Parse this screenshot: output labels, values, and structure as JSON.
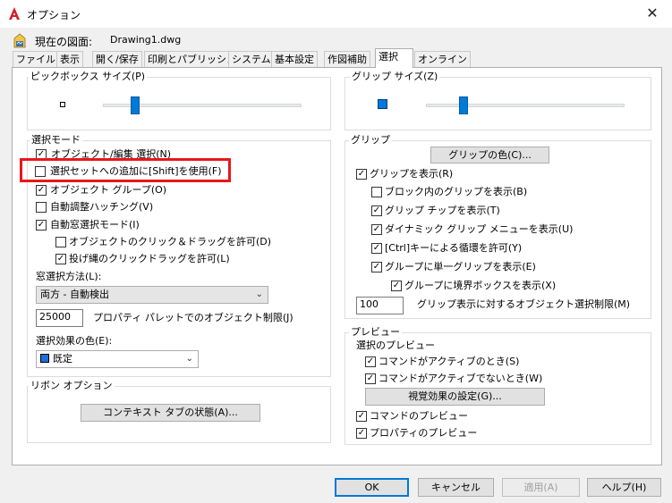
{
  "window": {
    "title": "オプション",
    "close_glyph": "✕"
  },
  "profile": {
    "current_drawing_label": "現在の図面:",
    "current_drawing_value": "Drawing1.dwg"
  },
  "tabs": [
    "ファイル",
    "表示",
    "開く/保存",
    "印刷とパブリッシュ",
    "システム",
    "基本設定",
    "作図補助",
    "選択",
    "オンライン"
  ],
  "active_tab": "選択",
  "pickbox": {
    "title": "ピックボックス サイズ(P)",
    "level_fraction": 0.16
  },
  "grip_size": {
    "title": "グリップ サイズ(Z)",
    "level_fraction": 0.19
  },
  "selection_modes": {
    "title": "選択モード",
    "items": [
      {
        "label": "オブジェクト/編集 選択(N)",
        "checked": true
      },
      {
        "label": "選択セットへの追加に[Shift]を使用(F)",
        "checked": false
      },
      {
        "label": "オブジェクト グループ(O)",
        "checked": true
      },
      {
        "label": "自動調整ハッチング(V)",
        "checked": false
      },
      {
        "label": "自動窓選択モード(I)",
        "checked": true
      },
      {
        "label": "オブジェクトのクリック＆ドラッグを許可(D)",
        "checked": false
      },
      {
        "label": "投げ縄のクリックドラッグを許可(L)",
        "checked": true
      }
    ],
    "window_method_label": "窓選択方法(L):",
    "window_method_value": "両方 - 自動検出",
    "object_limit_value": "25000",
    "object_limit_label": "プロパティ パレットでのオブジェクト制限(J)",
    "effect_color_label": "選択効果の色(E):",
    "effect_color_value": "既定",
    "effect_color_swatch": "#1e6fd9"
  },
  "ribbon": {
    "title": "リボン オプション",
    "context_tab_button": "コンテキスト タブの状態(A)..."
  },
  "grips": {
    "title": "グリップ",
    "color_button": "グリップの色(C)...",
    "items": [
      {
        "label": "グリップを表示(R)",
        "checked": true
      },
      {
        "label": "ブロック内のグリップを表示(B)",
        "checked": false
      },
      {
        "label": "グリップ チップを表示(T)",
        "checked": true
      },
      {
        "label": "ダイナミック グリップ メニューを表示(U)",
        "checked": true
      },
      {
        "label": "[Ctrl]キーによる循環を許可(Y)",
        "checked": true
      },
      {
        "label": "グループに単一グリップを表示(E)",
        "checked": true
      },
      {
        "label": "グループに境界ボックスを表示(X)",
        "checked": true
      }
    ],
    "limit_value": "100",
    "limit_label": "グリップ表示に対するオブジェクト選択制限(M)"
  },
  "preview": {
    "title": "プレビュー",
    "subtitle": "選択のプレビュー",
    "items": [
      {
        "label": "コマンドがアクティブのとき(S)",
        "checked": true
      },
      {
        "label": "コマンドがアクティブでないとき(W)",
        "checked": true
      }
    ],
    "visual_effects_button": "視覚効果の設定(G)...",
    "command_preview": {
      "label": "コマンドのプレビュー",
      "checked": true
    },
    "property_preview": {
      "label": "プロパティのプレビュー",
      "checked": true
    }
  },
  "footer": {
    "ok": "OK",
    "cancel": "キャンセル",
    "apply": "適用(A)",
    "help": "ヘルプ(H)"
  },
  "colors": {
    "accent": "#0078d7",
    "highlight": "#e8161c",
    "slider": "#007ad9"
  },
  "icons": {
    "check": "✓",
    "dropdown": "⌄"
  }
}
